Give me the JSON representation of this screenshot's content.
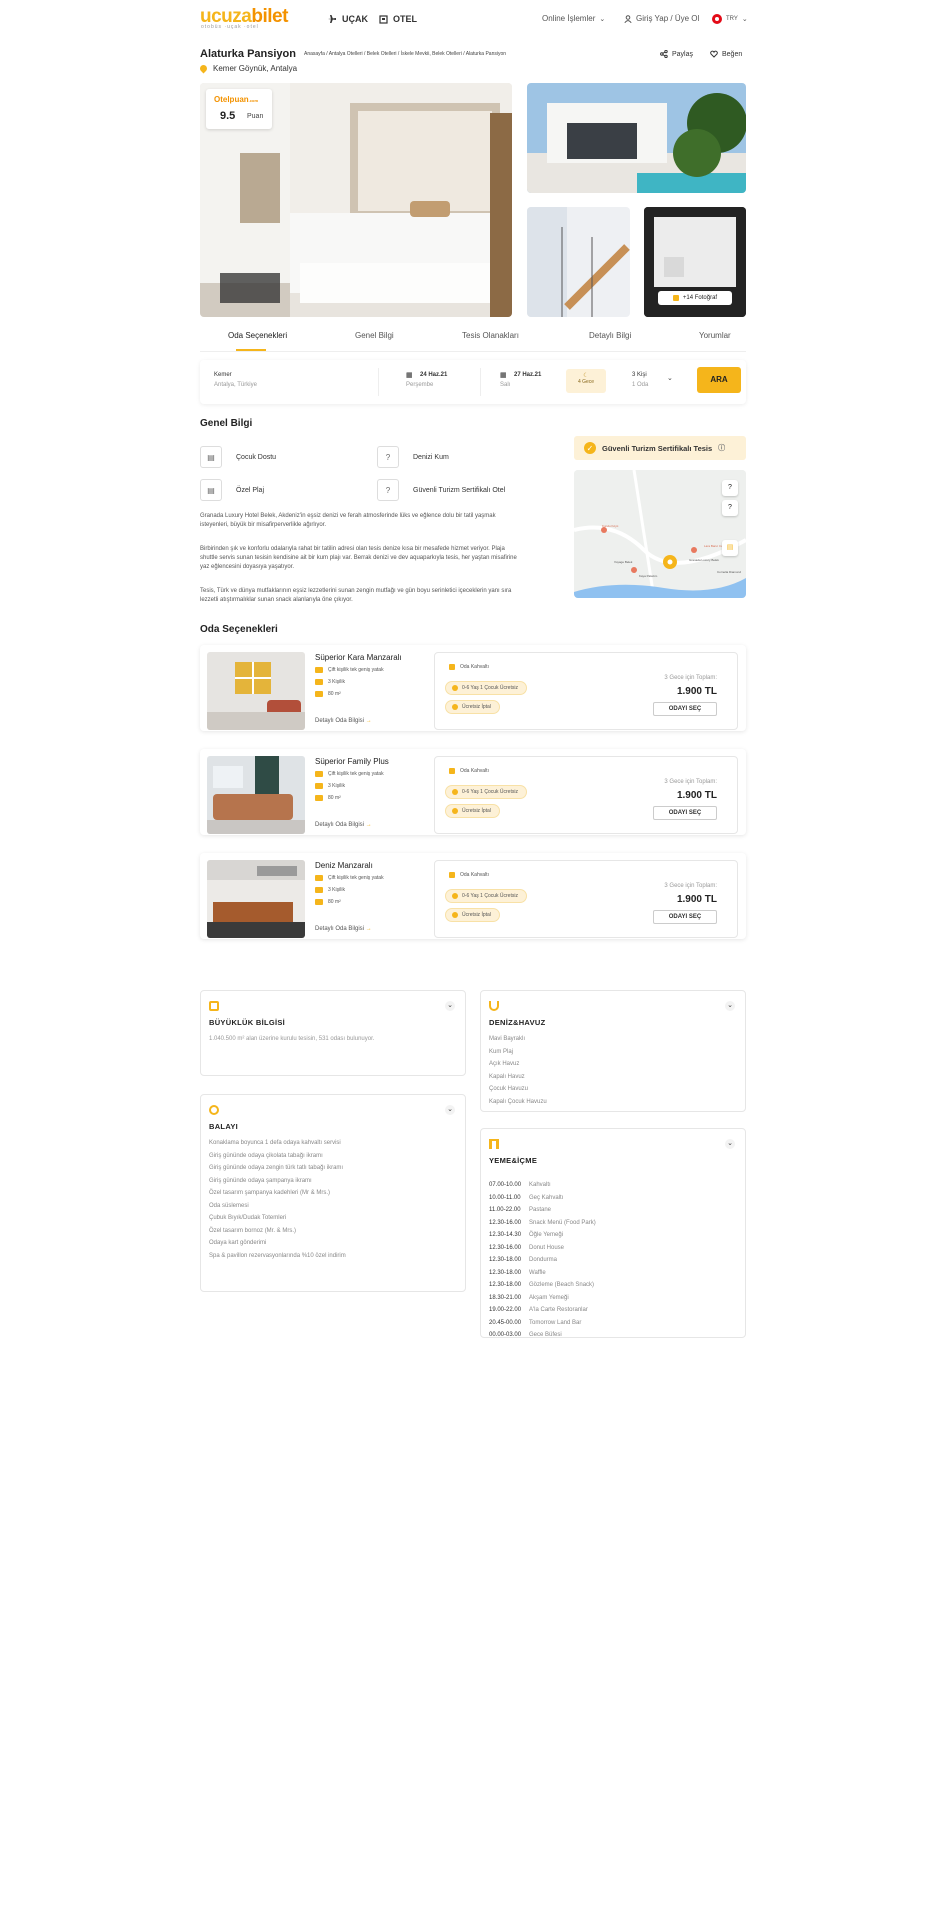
{
  "header": {
    "logo_main": "ucuza",
    "logo_accent": "bilet",
    "logo_sub": "otobüs ·uçak ·otel",
    "nav": [
      {
        "label": "UÇAK",
        "icon": "plane-icon"
      },
      {
        "label": "OTEL",
        "icon": "hotel-icon"
      }
    ],
    "online_label": "Online İşlemler",
    "login_label": "Giriş Yap / Üye Ol",
    "currency": "TRY"
  },
  "hotel": {
    "name": "Alaturka Pansiyon",
    "breadcrumb": "Anasayfa / Antalya Otelleri / Belek Otelleri / İskele Mevkii, Belek Otelleri / Alaturka Pansiyon",
    "location": "Kemer Göynük, Antalya",
    "share_label": "Paylaş",
    "like_label": "Beğen",
    "score_brand": "Otelpuan",
    "score_brand_suffix": ".com",
    "score": "9.5",
    "score_label": "Puan",
    "more_photos": "+14 Fotoğraf"
  },
  "tabs": [
    "Oda Seçenekleri",
    "Genel Bilgi",
    "Tesis Olanakları",
    "Detaylı Bilgi",
    "Yorumlar"
  ],
  "search": {
    "place": "Kemer",
    "place_sub": "Antalya, Türkiye",
    "checkin": "24 Haz.21",
    "checkin_day": "Perşembe",
    "checkout": "27 Haz.21",
    "checkout_day": "Salı",
    "nights": "4 Gece",
    "guests": "3 Kişi",
    "rooms": "1 Oda",
    "button": "ARA"
  },
  "general": {
    "title": "Genel Bilgi",
    "features": [
      "Çocuk Dostu",
      "Denizi Kum",
      "Özel Plaj",
      "Güvenli Turizm Sertifikalı Otel"
    ],
    "p1": "Granada Luxury Hotel Belek, Akdeniz'in eşsiz denizi ve ferah atmosferinde lüks ve eğlence dolu bir tatil yaşmak isteyenleri, büyük bir misafirperverlikle ağırlıyor.",
    "p2": "Birbirinden şık ve konforlu odalarıyla rahat bir tatilin adresi olan tesis denize kısa bir mesafede hizmet veriyor. Plaja shuttle servis sunan tesisin kendisine ait bir kum plajı var. Berrak denizi ve dev aquaparkıyla tesis, her yaştan misafirine yaz eğlencesini doyasıya yaşatıyor.",
    "p3": "Tesis, Türk ve dünya mutfaklarının eşsiz lezzetlerini sunan zengin mutfağı ve gün boyu serinletici içeceklerin yanı sıra lezzetli atıştırmalıklar sunan snack alanlarıyla öne çıkıyor.",
    "cert": "Güvenli Turizm Sertifikalı Tesis",
    "map_labels": [
      "Kundu Köyü",
      "Voyage Belek",
      "Lara Barut Collection",
      "Granada Luxury Belek",
      "Kaya Palazzo",
      "Cornelia Diamond"
    ]
  },
  "rooms_title": "Oda Seçenekleri",
  "rooms": [
    {
      "name": "Süperior Kara Manzaralı",
      "bed": "Çift kişilik tek geniş yatak",
      "cap": "3 Kişilik",
      "size": "80 m²",
      "detail": "Detaylı Oda Bilgisi",
      "board": "Oda Kahvaltı",
      "kids": "0-6 Yaş 1 Çocuk Ücretsiz",
      "cancel": "Ücretsiz İptal",
      "total_label": "3 Gece için Toplam:",
      "price": "1.900 TL",
      "select": "ODAYI SEÇ"
    },
    {
      "name": "Süperior Family Plus",
      "bed": "Çift kişilik tek geniş yatak",
      "cap": "3 Kişilik",
      "size": "80 m²",
      "detail": "Detaylı Oda Bilgisi",
      "board": "Oda Kahvaltı",
      "kids": "0-6 Yaş 1 Çocuk Ücretsiz",
      "cancel": "Ücretsiz İptal",
      "total_label": "3 Gece için Toplam:",
      "price": "1.900 TL",
      "select": "ODAYI SEÇ"
    },
    {
      "name": "Deniz Manzaralı",
      "bed": "Çift kişilik tek geniş yatak",
      "cap": "3 Kişilik",
      "size": "80 m²",
      "detail": "Detaylı Oda Bilgisi",
      "board": "Oda Kahvaltı",
      "kids": "0-6 Yaş 1 Çocuk Ücretsiz",
      "cancel": "Ücretsiz İptal",
      "total_label": "3 Gece için Toplam:",
      "price": "1.900 TL",
      "select": "ODAYI SEÇ"
    }
  ],
  "cards": {
    "size": {
      "title": "BÜYÜKLÜK BİLGİSİ",
      "text": "1.040.500 m² alan üzerine kurulu tesisin, 531 odası bulunuyor."
    },
    "sea": {
      "title": "DENİZ&HAVUZ",
      "items": [
        "Mavi Bayraklı",
        "Kum Plaj",
        "Açık Havuz",
        "Kapalı Havuz",
        "Çocuk Havuzu",
        "Kapalı Çocuk Havuzu"
      ]
    },
    "honeymoon": {
      "title": "BALAYI",
      "items": [
        "Konaklama boyunca 1 defa odaya kahvaltı servisi",
        "Giriş gününde odaya çikolata tabağı ikramı",
        "Giriş gününde odaya zengin türk tatlı tabağı ikramı",
        "Giriş gününde odaya şampanya ikramı",
        "Özel tasarım şampanya kadehleri (Mr & Mrs.)",
        "Oda süslemesi",
        "Çubuk Bıyık/Dudak Totemleri",
        "Özel tasarım bornoz (Mr. & Mrs.)",
        "Odaya kart gönderimi",
        "Spa & pavillon rezervasyonlarında %10 özel indirim"
      ]
    },
    "food": {
      "title": "YEME&İÇME",
      "schedule": [
        {
          "time": "07.00-10.00",
          "name": "Kahvaltı"
        },
        {
          "time": "10.00-11.00",
          "name": "Geç Kahvaltı"
        },
        {
          "time": "11.00-22.00",
          "name": "Pastane"
        },
        {
          "time": "12.30-16.00",
          "name": "Snack Menü (Food Park)"
        },
        {
          "time": "12.30-14.30",
          "name": "Öğle Yemeği"
        },
        {
          "time": "12.30-16.00",
          "name": "Donut House"
        },
        {
          "time": "12.30-18.00",
          "name": "Dondurma"
        },
        {
          "time": "12.30-18.00",
          "name": "Waffle"
        },
        {
          "time": "12.30-18.00",
          "name": "Gözleme (Beach Snack)"
        },
        {
          "time": "18.30-21.00",
          "name": "Akşam Yemeği"
        },
        {
          "time": "19.00-22.00",
          "name": "A'la Carte Restoranlar"
        },
        {
          "time": "20.45-00.00",
          "name": "Tomorrow Land Bar"
        },
        {
          "time": "00.00-03.00",
          "name": "Gece Büfesi"
        }
      ]
    }
  },
  "colors": {
    "accent": "#f5b51b",
    "accent_dark": "#f39200",
    "pill_bg": "#fdf1d7"
  }
}
